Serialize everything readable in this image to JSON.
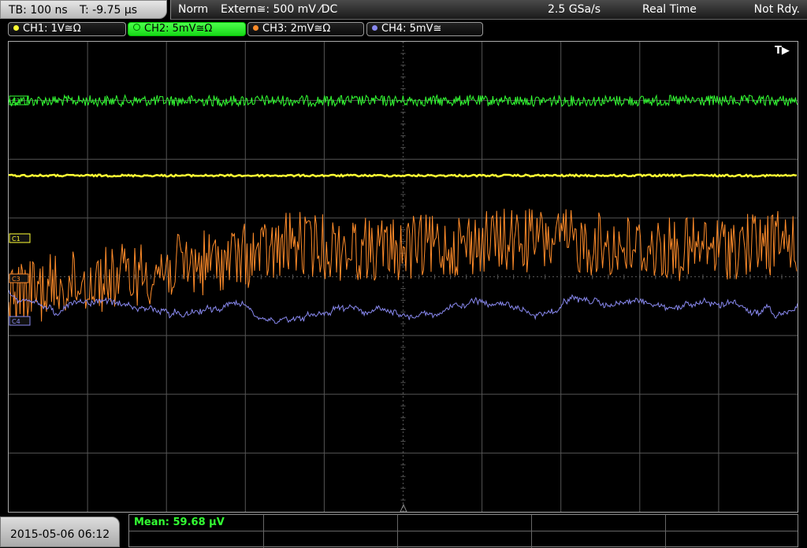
{
  "topbar": {
    "timebase": "TB: 100 ns",
    "trigger_pos": "T: -9.75 µs",
    "trigger_mode": "Norm",
    "trigger_source": "Extern≅: 500 mV ⁄DC",
    "sample_rate": "2.5 GSa/s",
    "acq_mode": "Real Time",
    "status": "Not Rdy."
  },
  "channels": [
    {
      "label": "CH1: 1V≅Ω",
      "color": "#ffff33",
      "marker": "C1"
    },
    {
      "label": "CH2: 5mV≅Ω",
      "color": "#33ff33",
      "marker": "C2"
    },
    {
      "label": "CH3: 2mV≅Ω",
      "color": "#ff8c2a",
      "marker": "C3"
    },
    {
      "label": "CH4: 5mV≅",
      "color": "#8888ee",
      "marker": "C4"
    }
  ],
  "trigger_marker": "T▶",
  "footer": {
    "datetime": "2015-05-06 06:12",
    "mean": "Mean: 59.68 µV"
  },
  "grid": {
    "color": "#555555"
  }
}
